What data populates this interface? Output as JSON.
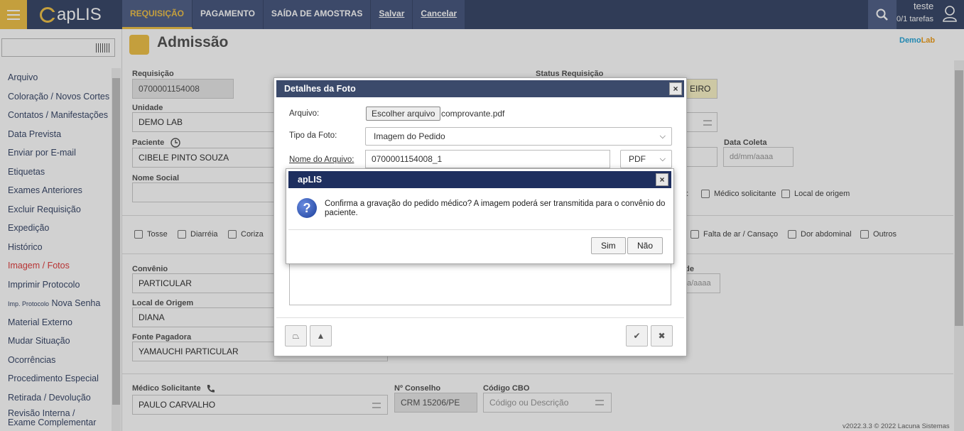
{
  "app": {
    "logo": "apLIS"
  },
  "nav": {
    "requisicao": "REQUISIÇÃO",
    "pagamento": "PAGAMENTO",
    "saida": "SAÍDA DE AMOSTRAS",
    "salvar": "Salvar",
    "cancelar": "Cancelar"
  },
  "user": {
    "name": "teste",
    "tasks": "0/1 tarefas"
  },
  "sidebar": {
    "items": [
      "Arquivo",
      "Coloração / Novos Cortes",
      "Contatos / Manifestações",
      "Data Prevista",
      "Enviar por E-mail",
      "Etiquetas",
      "Exames Anteriores",
      "Excluir Requisição",
      "Expedição",
      "Histórico",
      "Imagem / Fotos",
      "Imprimir Protocolo",
      "Imp. Protocolo",
      "Nova Senha",
      "Material Externo",
      "Mudar Situação",
      "Ocorrências",
      "Procedimento Especial",
      "Retirada / Devolução",
      "Revisão Interna /",
      "Exame Complementar"
    ]
  },
  "page": {
    "title": "Admissão",
    "brand": "Demo",
    "brand2": "Lab",
    "version": "v2022.3.3   © 2022 Lacuna Sistemas"
  },
  "form": {
    "requisicao_label": "Requisição",
    "requisicao_value": "0700001154008",
    "status_label": "Status Requisição",
    "status_value": "EIRO",
    "unidade_label": "Unidade",
    "unidade_value": "DEMO LAB",
    "paciente_label": "Paciente",
    "paciente_value": "CIBELE PINTO SOUZA",
    "data_coleta_label": "Data Coleta",
    "data_coleta_placeholder": "dd/mm/aaaa",
    "nome_social_label": "Nome Social",
    "m_label": "m:",
    "medico_sol_check": "Médico solicitante",
    "local_origem_check": "Local de origem",
    "symptoms": [
      "Tosse",
      "Diarréia",
      "Coriza",
      "Falta de ar / Cansaço",
      "Dor abdominal",
      "Outros"
    ],
    "convenio_label": "Convênio",
    "convenio_value": "PARTICULAR",
    "ade_label": "ade",
    "ade_value": "a/aaaa",
    "local_origem_label": "Local de Origem",
    "local_origem_value": "DIANA",
    "fonte_label": "Fonte Pagadora",
    "fonte_value": "YAMAUCHI PARTICULAR",
    "medico_label": "Médico Solicitante",
    "medico_value": "PAULO CARVALHO",
    "conselho_label": "Nº Conselho",
    "conselho_value": "CRM 15206/PE",
    "cbo_label": "Código CBO",
    "cbo_placeholder": "Código ou Descrição"
  },
  "photo_dialog": {
    "title": "Detalhes da Foto",
    "arquivo_label": "Arquivo:",
    "choose_button": "Escolher arquivo",
    "file_name": "comprovante.pdf",
    "tipo_label": "Tipo da Foto:",
    "tipo_value": "Imagem do Pedido",
    "nome_label": "Nome do Arquivo:",
    "nome_value": "0700001154008_1",
    "ext_value": "PDF",
    "close": "×"
  },
  "confirm_dialog": {
    "title": "apLIS",
    "message": "Confirma a gravação do pedido médico? A imagem poderá ser transmitida para o convênio do paciente.",
    "yes": "Sim",
    "no": "Não",
    "close": "×"
  }
}
